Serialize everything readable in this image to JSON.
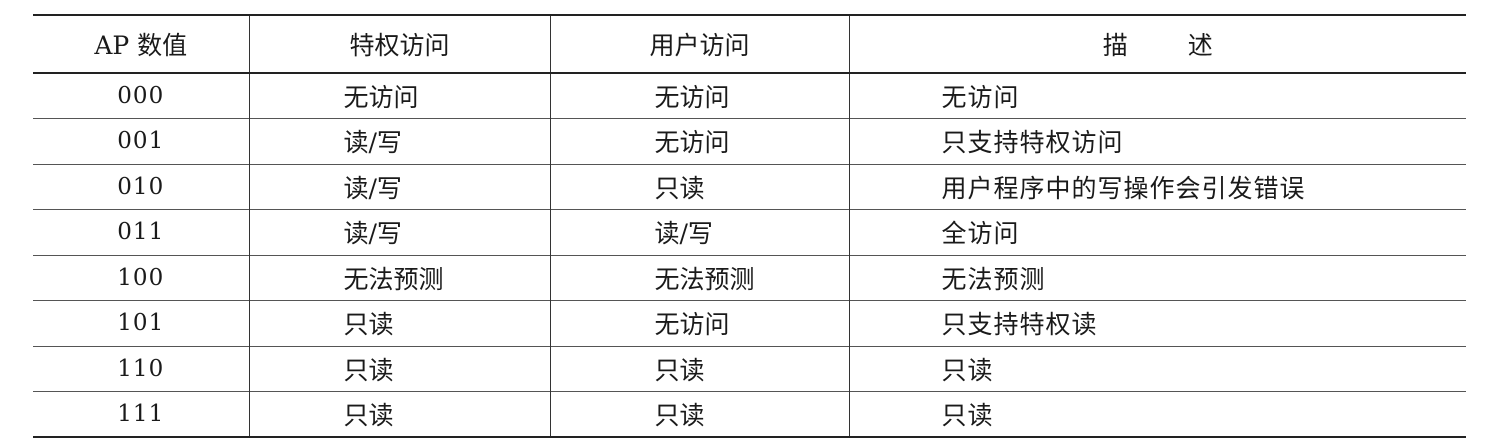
{
  "table": {
    "headers": {
      "ap_value": "AP 数值",
      "privileged_access": "特权访问",
      "user_access": "用户访问",
      "description_part1": "描",
      "description_part2": "述"
    },
    "rows": [
      {
        "ap": "000",
        "privileged": "无访问",
        "user": "无访问",
        "description": "无访问"
      },
      {
        "ap": "001",
        "privileged": "读/写",
        "user": "无访问",
        "description": "只支持特权访问"
      },
      {
        "ap": "010",
        "privileged": "读/写",
        "user": "只读",
        "description": "用户程序中的写操作会引发错误"
      },
      {
        "ap": "011",
        "privileged": "读/写",
        "user": "读/写",
        "description": "全访问"
      },
      {
        "ap": "100",
        "privileged": "无法预测",
        "user": "无法预测",
        "description": "无法预测"
      },
      {
        "ap": "101",
        "privileged": "只读",
        "user": "无访问",
        "description": "只支持特权读"
      },
      {
        "ap": "110",
        "privileged": "只读",
        "user": "只读",
        "description": "只读"
      },
      {
        "ap": "111",
        "privileged": "只读",
        "user": "只读",
        "description": "只读"
      }
    ]
  }
}
